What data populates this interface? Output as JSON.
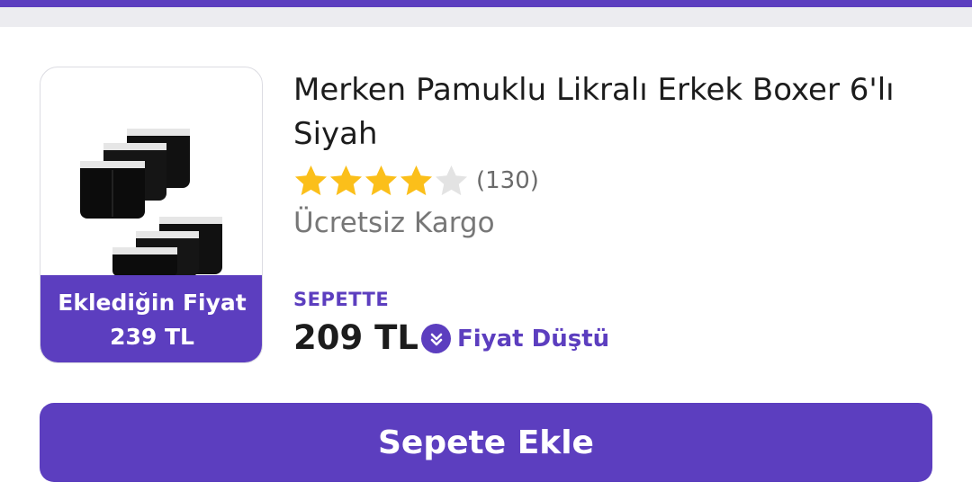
{
  "product": {
    "title": "Merken Pamuklu Likralı Erkek Boxer 6'lı Siyah",
    "rating": 4,
    "rating_max": 5,
    "review_count": "(130)",
    "shipping": "Ücretsiz Kargo"
  },
  "added_price": {
    "label": "Eklediğin Fiyat",
    "value": "239 TL"
  },
  "cart": {
    "label": "SEPETTE",
    "price": "209 TL",
    "badge": "Fiyat Düştü",
    "badge_icon": "double-chevron-down-icon"
  },
  "action": {
    "add_to_cart": "Sepete Ekle"
  },
  "colors": {
    "brand": "#5c3ebf",
    "star_filled": "#fbbf1a",
    "star_empty": "#e3e3e3"
  }
}
